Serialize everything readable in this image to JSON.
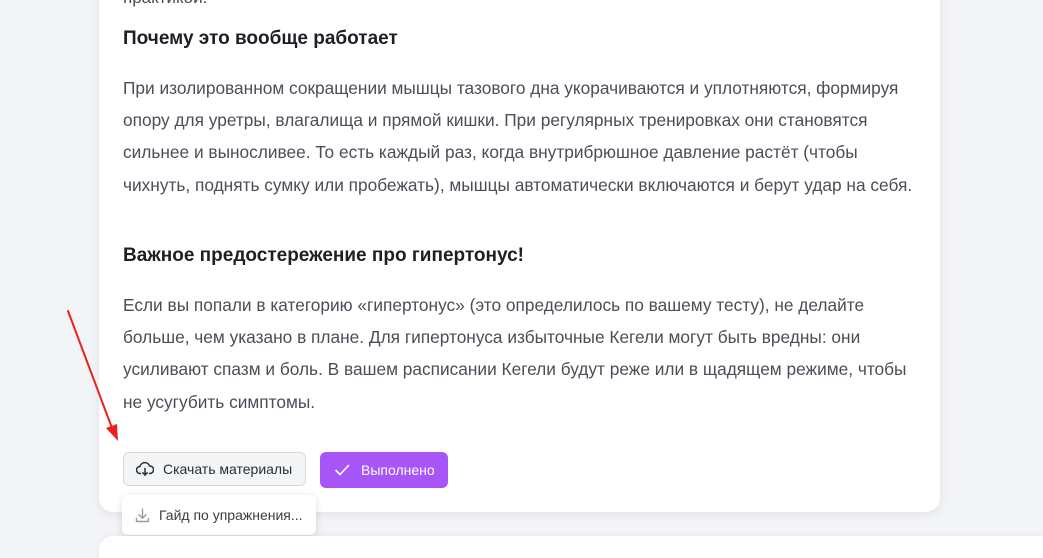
{
  "prev_paragraph_tail": "практикой.",
  "sections": [
    {
      "heading": "Почему это вообще работает",
      "text": "При изолированном сокращении мышцы тазового дна укорачиваются и уплотняются, формируя опору для уретры, влагалища и прямой кишки. При регулярных тренировках они становятся сильнее и выносливее. То есть каждый раз, когда внутрибрюшное давление растёт (чтобы чихнуть, поднять сумку или пробежать), мышцы автоматически включаются и берут удар на себя."
    },
    {
      "heading": "Важное предостережение про гипертонус!",
      "text": "Если вы попали в категорию «гипертонус» (это определилось по вашему тесту), не делайте больше, чем указано в плане. Для гипертонуса избыточные Кегели могут быть вредны: они усиливают спазм и боль. В вашем расписании Кегели будут реже или в щадящем режиме, чтобы не усугубить симптомы."
    }
  ],
  "actions": {
    "download_label": "Скачать материалы",
    "download_icon": "cloud-download-icon",
    "done_label": "Выполнено",
    "done_icon": "checkmark-icon"
  },
  "dropdown": {
    "items": [
      {
        "label": "Гайд по упражнения...",
        "icon": "download-icon"
      }
    ]
  },
  "colors": {
    "accent": "#a855f7",
    "annotation_arrow": "#e8231d",
    "page_bg": "#f3f4f7",
    "card_bg": "#ffffff"
  }
}
